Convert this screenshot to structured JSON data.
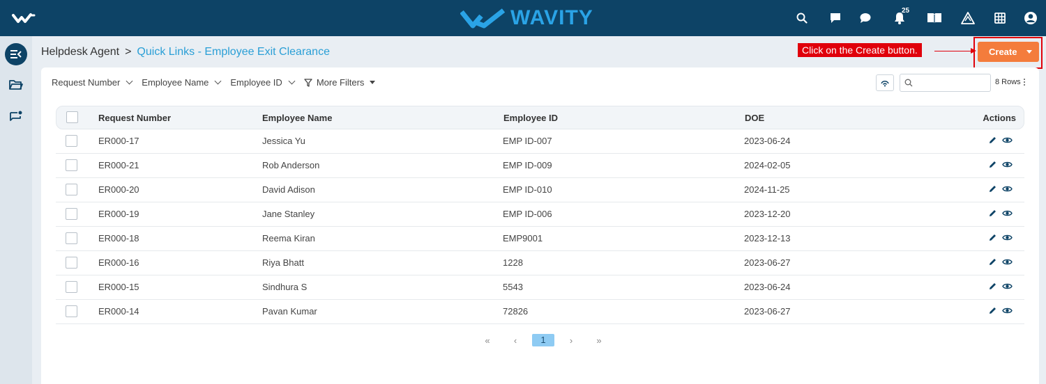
{
  "header": {
    "brand": "WAVITY",
    "notification_count": "25",
    "icons": [
      "search-icon",
      "chat-bubble-icon",
      "message-icon",
      "bell-icon",
      "book-icon",
      "warning-triangle-icon",
      "grid-icon",
      "user-avatar-icon"
    ]
  },
  "breadcrumb": {
    "root": "Helpdesk Agent",
    "separator": ">",
    "current": "Quick Links - Employee Exit Clearance"
  },
  "annotation": {
    "text": "Click on the Create button."
  },
  "toolbar": {
    "create_label": "Create"
  },
  "filters": [
    {
      "label": "Request Number"
    },
    {
      "label": "Employee Name"
    },
    {
      "label": "Employee ID"
    },
    {
      "label": "More Filters"
    }
  ],
  "search": {
    "placeholder": ""
  },
  "rows_label": "8 Rows",
  "table": {
    "headers": [
      "Request Number",
      "Employee Name",
      "Employee ID",
      "DOE",
      "Actions"
    ],
    "rows": [
      [
        "ER000-17",
        "Jessica Yu",
        "EMP ID-007",
        "2023-06-24"
      ],
      [
        "ER000-21",
        "Rob Anderson",
        "EMP ID-009",
        "2024-02-05"
      ],
      [
        "ER000-20",
        "David Adison",
        "EMP ID-010",
        "2024-11-25"
      ],
      [
        "ER000-19",
        "Jane Stanley",
        "EMP ID-006",
        "2023-12-20"
      ],
      [
        "ER000-18",
        "Reema Kiran",
        "EMP9001",
        "2023-12-13"
      ],
      [
        "ER000-16",
        "Riya Bhatt",
        "1228",
        "2023-06-27"
      ],
      [
        "ER000-15",
        "Sindhura S",
        "5543",
        "2023-06-24"
      ],
      [
        "ER000-14",
        "Pavan Kumar",
        "72826",
        "2023-06-27"
      ]
    ]
  },
  "pagination": {
    "first": "«",
    "prev": "‹",
    "current": "1",
    "next": "›",
    "last": "»"
  },
  "colors": {
    "topbar": "#0d4366",
    "brand": "#2aa3e6",
    "accent": "#f47c3c",
    "link": "#2a9fd6",
    "annotation": "#e0000b"
  }
}
